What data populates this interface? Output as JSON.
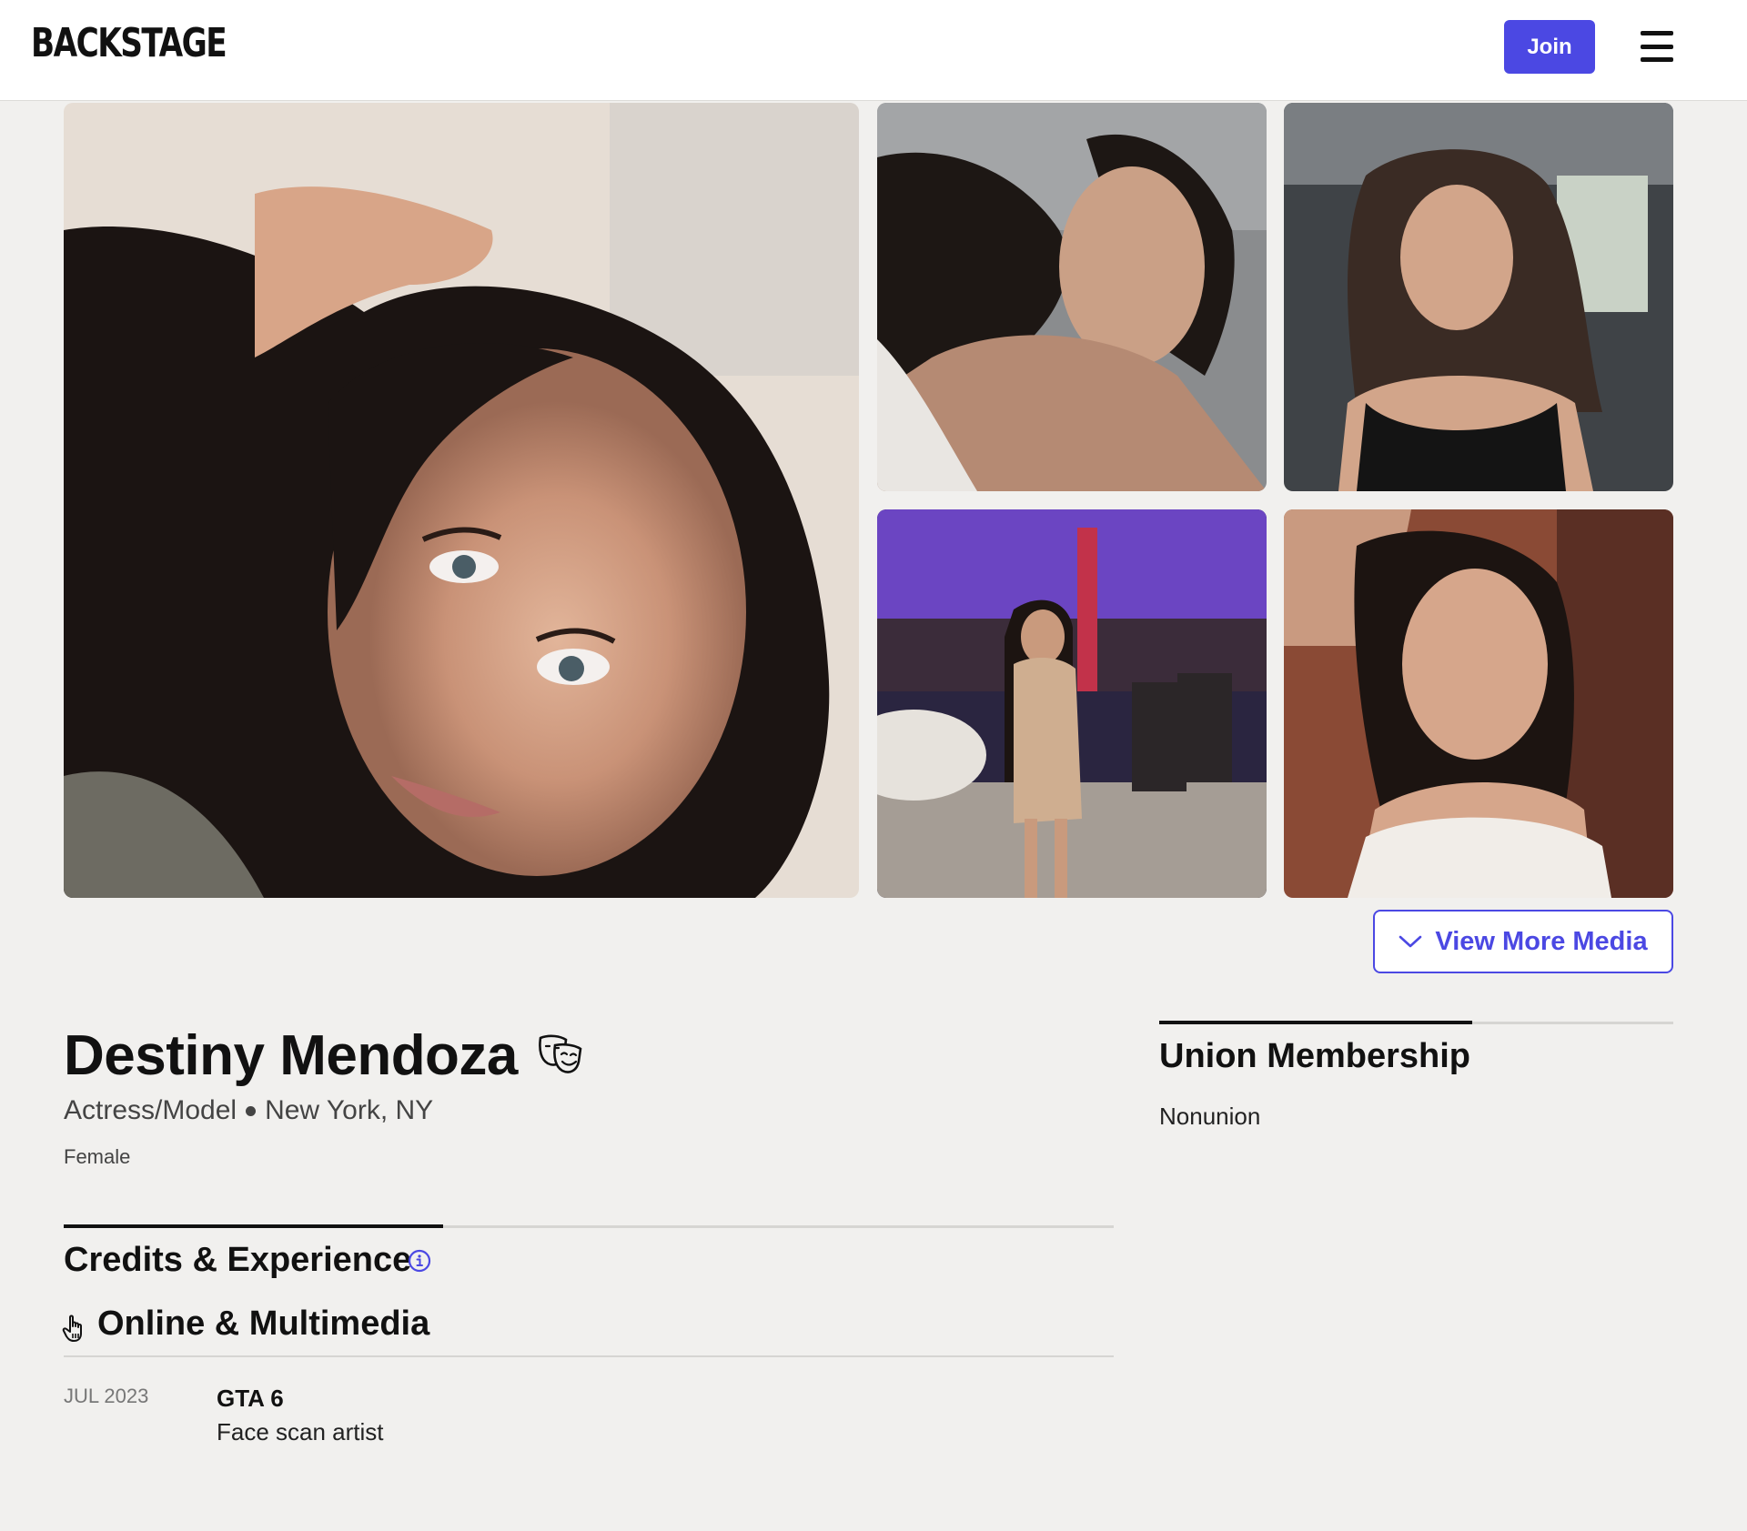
{
  "header": {
    "logo": "BACKSTAGE",
    "join_label": "Join",
    "menu_icon": "hamburger-menu-icon"
  },
  "media": {
    "photos": [
      {
        "name": "headshot-main",
        "description_hidden": true
      },
      {
        "name": "photo-2"
      },
      {
        "name": "photo-3"
      },
      {
        "name": "photo-4"
      },
      {
        "name": "photo-5"
      }
    ],
    "view_more_label": "View More Media"
  },
  "profile": {
    "name": "Destiny Mendoza",
    "roles": "Actress/Model",
    "location": "New York, NY",
    "gender": "Female"
  },
  "union": {
    "title": "Union Membership",
    "value": "Nonunion"
  },
  "credits": {
    "title": "Credits & Experience",
    "category": "Online & Multimedia",
    "items": [
      {
        "date": "JUL 2023",
        "title": "GTA 6",
        "role": "Face scan artist"
      }
    ]
  },
  "colors": {
    "accent": "#4b48e3",
    "background": "#f1f0ee"
  }
}
